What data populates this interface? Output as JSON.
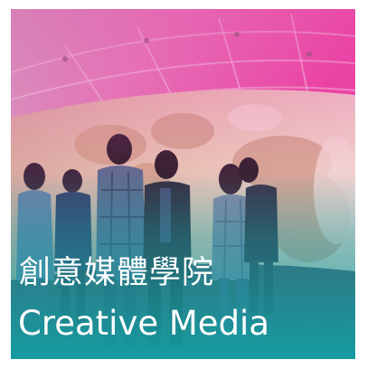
{
  "tile": {
    "title_zh": "創意媒體學院",
    "title_en": "Creative Media",
    "photo_label": "students-in-immersive-3d-theatre",
    "overlay_top_color": "#e64aa7",
    "overlay_bottom_color": "#19a0a3"
  }
}
